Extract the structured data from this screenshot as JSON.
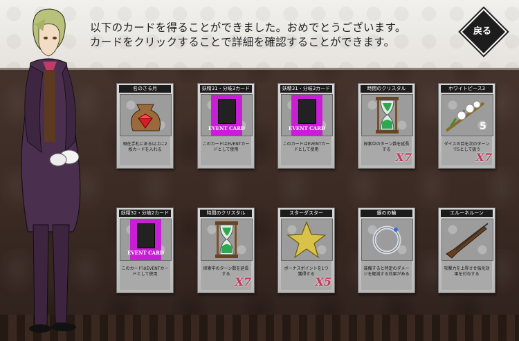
{
  "header": {
    "message_line1": "以下のカードを得ることができました。おめでとうございます。",
    "message_line2": "カードをクリックすることで詳細を確認することができます。",
    "back_label": "戻る"
  },
  "cards": [
    {
      "title": "名のさる月",
      "desc": "現在手札にある以上に2枚カードを入れる",
      "mult": "",
      "art": "gem-bag-icon"
    },
    {
      "title": "妖精31・分岐3カード",
      "desc": "このカードはEVENTカードとして使用",
      "mult": "",
      "art": "event-card-icon",
      "event": "EVENT CARD"
    },
    {
      "title": "妖精31・分岐3カード",
      "desc": "このカードはEVENTカードとして使用",
      "mult": "",
      "art": "event-card-icon",
      "event": "EVENT CARD"
    },
    {
      "title": "時間のクリスタル",
      "desc": "探索中のターン数を延長する",
      "mult": "X7",
      "art": "hourglass-icon"
    },
    {
      "title": "ホワイトピース3",
      "desc": "ダイスの目を次のターンで5として扱う",
      "mult": "X7",
      "art": "white-flower-icon"
    },
    {
      "title": "妖精32・分岐2カード",
      "desc": "このカードはEVENTカードとして使用",
      "mult": "",
      "art": "event-card-icon",
      "event": "EVENT CARD"
    },
    {
      "title": "時間のクリスタル",
      "desc": "探索中のターン数を延長する",
      "mult": "X7",
      "art": "hourglass-icon"
    },
    {
      "title": "スターダスター",
      "desc": "ボーナスポイントを1つ獲得する",
      "mult": "X5",
      "art": "star-icon"
    },
    {
      "title": "銀のの輪",
      "desc": "装備すると特定のダメージを軽減する効果がある",
      "mult": "",
      "art": "silver-ring-icon"
    },
    {
      "title": "エルーネルーン",
      "desc": "攻撃力を上昇させ強化効果を付与する",
      "mult": "",
      "art": "rifle-icon"
    }
  ]
}
